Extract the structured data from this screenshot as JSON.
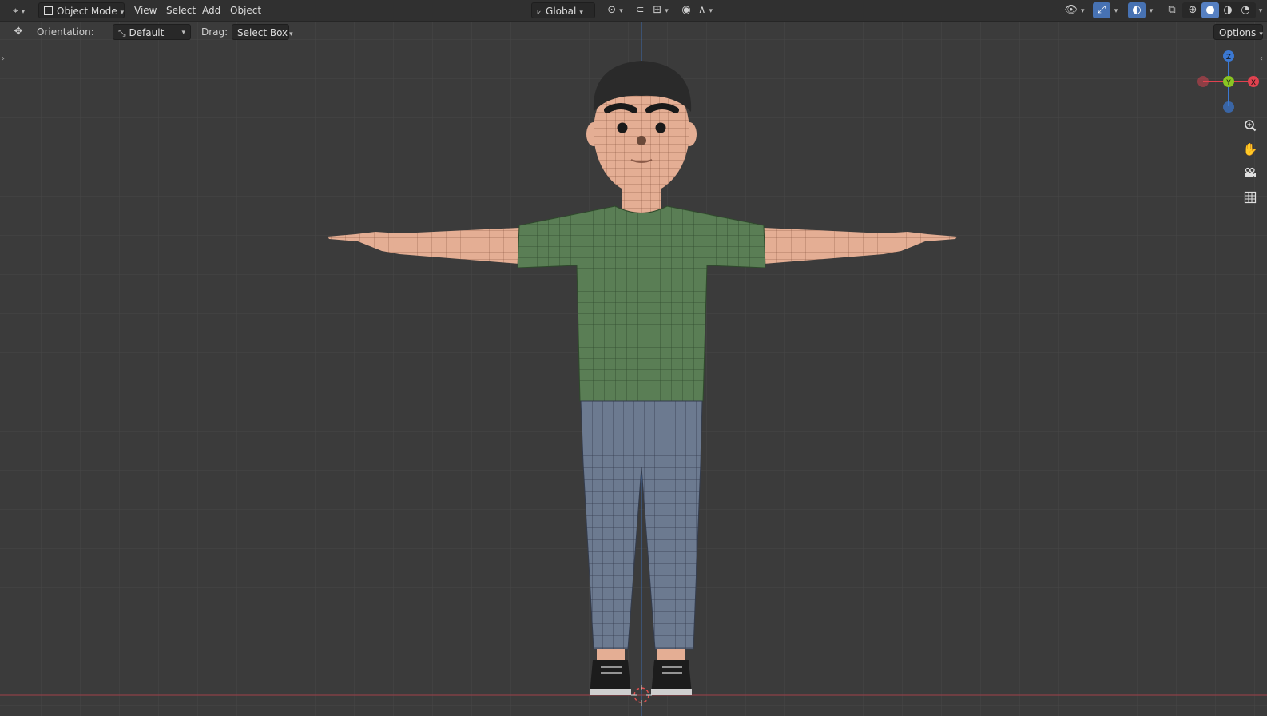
{
  "header": {
    "editor_type_icon": "viewport-editor-icon",
    "mode": "Object Mode",
    "menus": [
      "View",
      "Select",
      "Add",
      "Object"
    ],
    "transform_orientation": "Global",
    "pivot_icon": "pivot-point-icon",
    "snap_icon": "magnet-icon",
    "proportional_icon": "proportional-edit-icon",
    "visibility_icon": "eye-icon",
    "gizmo_icon": "gizmo-icon",
    "overlay_icon": "overlay-icon",
    "xray_icon": "xray-icon",
    "shading_modes": [
      "wireframe",
      "solid",
      "material",
      "rendered"
    ],
    "active_shading": "solid"
  },
  "toolbar": {
    "orientation_label": "Orientation:",
    "orientation_value": "Default",
    "drag_label": "Drag:",
    "drag_value": "Select Box",
    "options_label": "Options"
  },
  "gizmo": {
    "x_label": "X",
    "y_label": "Y",
    "z_label": "Z",
    "colors": {
      "x": "#e0424f",
      "y": "#8ac522",
      "z": "#3b78d1"
    }
  },
  "nav_controls": [
    "zoom-icon",
    "hand-pan-icon",
    "camera-icon",
    "grid-ortho-icon"
  ],
  "colors": {
    "background": "#3b3b3b",
    "grid": "#474747",
    "shirt": "#5a7e55",
    "pants": "#6c7a90",
    "skin": "#e4ae94",
    "hair": "#2a2a2a",
    "accent": "#4772b3"
  }
}
